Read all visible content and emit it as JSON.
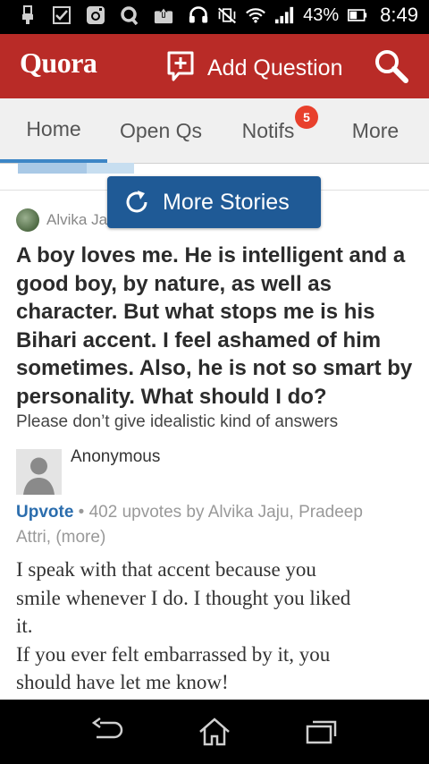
{
  "status_bar": {
    "battery_percent": "43%",
    "time": "8:49",
    "icons": [
      "usb-icon",
      "checkbox-icon",
      "instagram-icon",
      "q-icon",
      "upload-icon",
      "headset-icon",
      "no-vibrate-icon",
      "wifi-icon",
      "signal-icon",
      "battery-icon"
    ]
  },
  "header": {
    "logo": "Quora",
    "add_question": "Add Question",
    "brand_color": "#b92b27"
  },
  "tabs": [
    {
      "label": "Home",
      "active": true
    },
    {
      "label": "Open Qs",
      "active": false
    },
    {
      "label": "Notifs",
      "active": false,
      "badge": "5"
    },
    {
      "label": "More",
      "active": false
    }
  ],
  "more_stories": {
    "label": "More Stories"
  },
  "feed": {
    "author_name": "Alvika Ja",
    "question_lines": [
      "A boy loves me. He is intelligent and a",
      "good boy, by nature, as well as",
      "character. But what stops me is his",
      "Bihari accent. I feel ashamed of him",
      "sometimes. Also, he is not so smart by",
      "personality. What should I do?"
    ],
    "question_details": "Please don’t give idealistic kind of answers",
    "answer": {
      "author": "Anonymous",
      "upvote_label": "Upvote",
      "upvote_line_1": " • 402 upvotes by Alvika Jaju, Pradeep",
      "upvote_line_2": "Attri, (more)",
      "text_lines": [
        "I speak with that accent because you",
        "smile whenever I do. I thought you liked",
        "it.",
        "If you ever felt embarrassed by it, you",
        "should have let me know!"
      ]
    }
  }
}
